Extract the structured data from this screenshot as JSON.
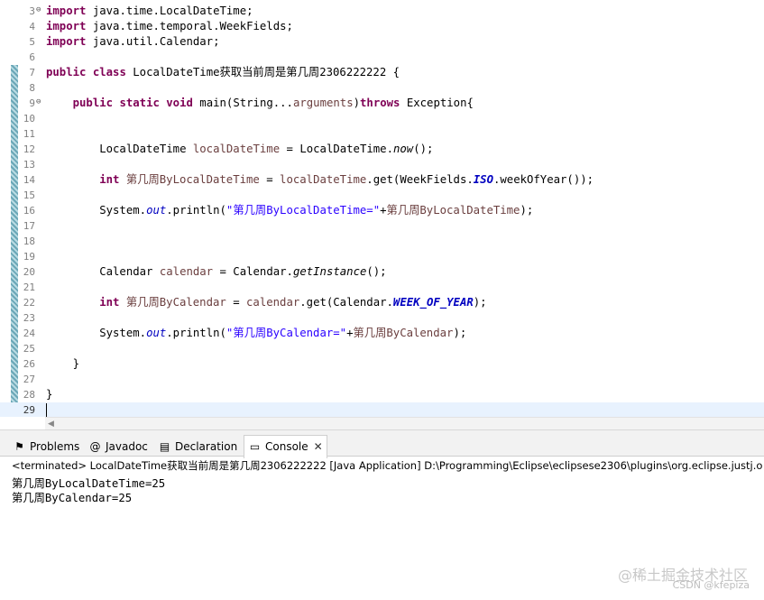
{
  "editor": {
    "lines": [
      {
        "no": "3",
        "fold": true,
        "tokens": [
          {
            "t": "import",
            "c": "kw"
          },
          {
            "t": " java.time.LocalDateTime;"
          }
        ]
      },
      {
        "no": "4",
        "tokens": [
          {
            "t": "import",
            "c": "kw"
          },
          {
            "t": " java.time.temporal.WeekFields;"
          }
        ]
      },
      {
        "no": "5",
        "tokens": [
          {
            "t": "import",
            "c": "kw"
          },
          {
            "t": " java.util.Calendar;"
          }
        ]
      },
      {
        "no": "6",
        "tokens": []
      },
      {
        "no": "7",
        "tokens": [
          {
            "t": "public",
            "c": "kw"
          },
          {
            "t": " "
          },
          {
            "t": "class",
            "c": "kw"
          },
          {
            "t": " LocalDateTime"
          },
          {
            "t": "获取当前周是第几周",
            "c": "cjk"
          },
          {
            "t": "2306222222 {"
          }
        ]
      },
      {
        "no": "8",
        "tokens": []
      },
      {
        "no": "9",
        "fold": true,
        "tokens": [
          {
            "t": "    "
          },
          {
            "t": "public",
            "c": "kw"
          },
          {
            "t": " "
          },
          {
            "t": "static",
            "c": "kw"
          },
          {
            "t": " "
          },
          {
            "t": "void",
            "c": "kw"
          },
          {
            "t": " main(String..."
          },
          {
            "t": "arguments",
            "c": "loc"
          },
          {
            "t": ")"
          },
          {
            "t": "throws",
            "c": "kw"
          },
          {
            "t": " Exception{"
          }
        ]
      },
      {
        "no": "10",
        "tokens": []
      },
      {
        "no": "11",
        "tokens": []
      },
      {
        "no": "12",
        "tokens": [
          {
            "t": "        LocalDateTime "
          },
          {
            "t": "localDateTime",
            "c": "loc"
          },
          {
            "t": " = LocalDateTime."
          },
          {
            "t": "now",
            "c": "it"
          },
          {
            "t": "();"
          }
        ]
      },
      {
        "no": "13",
        "tokens": []
      },
      {
        "no": "14",
        "tokens": [
          {
            "t": "        "
          },
          {
            "t": "int",
            "c": "kw"
          },
          {
            "t": " "
          },
          {
            "t": "第几周",
            "c": "cjk loc"
          },
          {
            "t": "ByLocalDateTime",
            "c": "loc"
          },
          {
            "t": " = "
          },
          {
            "t": "localDateTime",
            "c": "loc"
          },
          {
            "t": ".get(WeekFields."
          },
          {
            "t": "ISO",
            "c": "cst"
          },
          {
            "t": ".weekOfYear());"
          }
        ]
      },
      {
        "no": "15",
        "tokens": []
      },
      {
        "no": "16",
        "tokens": [
          {
            "t": "        System."
          },
          {
            "t": "out",
            "c": "fld"
          },
          {
            "t": ".println("
          },
          {
            "t": "\"",
            "c": "str"
          },
          {
            "t": "第几周",
            "c": "cjk str"
          },
          {
            "t": "ByLocalDateTime=\"",
            "c": "str"
          },
          {
            "t": "+"
          },
          {
            "t": "第几周",
            "c": "cjk loc"
          },
          {
            "t": "ByLocalDateTime",
            "c": "loc"
          },
          {
            "t": ");"
          }
        ]
      },
      {
        "no": "17",
        "tokens": []
      },
      {
        "no": "18",
        "tokens": []
      },
      {
        "no": "19",
        "tokens": []
      },
      {
        "no": "20",
        "tokens": [
          {
            "t": "        Calendar "
          },
          {
            "t": "calendar",
            "c": "loc"
          },
          {
            "t": " = Calendar."
          },
          {
            "t": "getInstance",
            "c": "it"
          },
          {
            "t": "();"
          }
        ]
      },
      {
        "no": "21",
        "tokens": []
      },
      {
        "no": "22",
        "tokens": [
          {
            "t": "        "
          },
          {
            "t": "int",
            "c": "kw"
          },
          {
            "t": " "
          },
          {
            "t": "第几周",
            "c": "cjk loc"
          },
          {
            "t": "ByCalendar",
            "c": "loc"
          },
          {
            "t": " = "
          },
          {
            "t": "calendar",
            "c": "loc"
          },
          {
            "t": ".get(Calendar."
          },
          {
            "t": "WEEK_OF_YEAR",
            "c": "cst"
          },
          {
            "t": ");"
          }
        ]
      },
      {
        "no": "23",
        "tokens": []
      },
      {
        "no": "24",
        "tokens": [
          {
            "t": "        System."
          },
          {
            "t": "out",
            "c": "fld"
          },
          {
            "t": ".println("
          },
          {
            "t": "\"",
            "c": "str"
          },
          {
            "t": "第几周",
            "c": "cjk str"
          },
          {
            "t": "ByCalendar=\"",
            "c": "str"
          },
          {
            "t": "+"
          },
          {
            "t": "第几周",
            "c": "cjk loc"
          },
          {
            "t": "ByCalendar",
            "c": "loc"
          },
          {
            "t": ");"
          }
        ]
      },
      {
        "no": "25",
        "tokens": []
      },
      {
        "no": "26",
        "tokens": [
          {
            "t": "    }"
          }
        ]
      },
      {
        "no": "27",
        "tokens": []
      },
      {
        "no": "28",
        "tokens": [
          {
            "t": "}"
          }
        ]
      },
      {
        "no": "29",
        "current": true,
        "tokens": []
      }
    ]
  },
  "views": {
    "tabs": [
      {
        "label": "Problems",
        "icon": "problems-icon",
        "glyph": "⚑"
      },
      {
        "label": "Javadoc",
        "icon": "javadoc-icon",
        "glyph": "@"
      },
      {
        "label": "Declaration",
        "icon": "declaration-icon",
        "glyph": "▤"
      },
      {
        "label": "Console",
        "icon": "console-icon",
        "glyph": "▭",
        "active": true
      }
    ],
    "close_glyph": "✕",
    "console_header": "<terminated> LocalDateTime获取当前周是第几周2306222222 [Java Application] D:\\Programming\\Eclipse\\eclipsese2306\\plugins\\org.eclipse.justj.o",
    "console_lines": [
      "第几周ByLocalDateTime=25",
      "第几周ByCalendar=25"
    ]
  },
  "watermark": {
    "line1": "@稀土掘金技术社区",
    "line2": "CSDN @kfepiza"
  },
  "colors": {
    "keyword": "#7f0055",
    "string": "#2a00ff",
    "field": "#0000c0",
    "local_var": "#6a3e3e",
    "current_line": "#e8f2fe"
  }
}
